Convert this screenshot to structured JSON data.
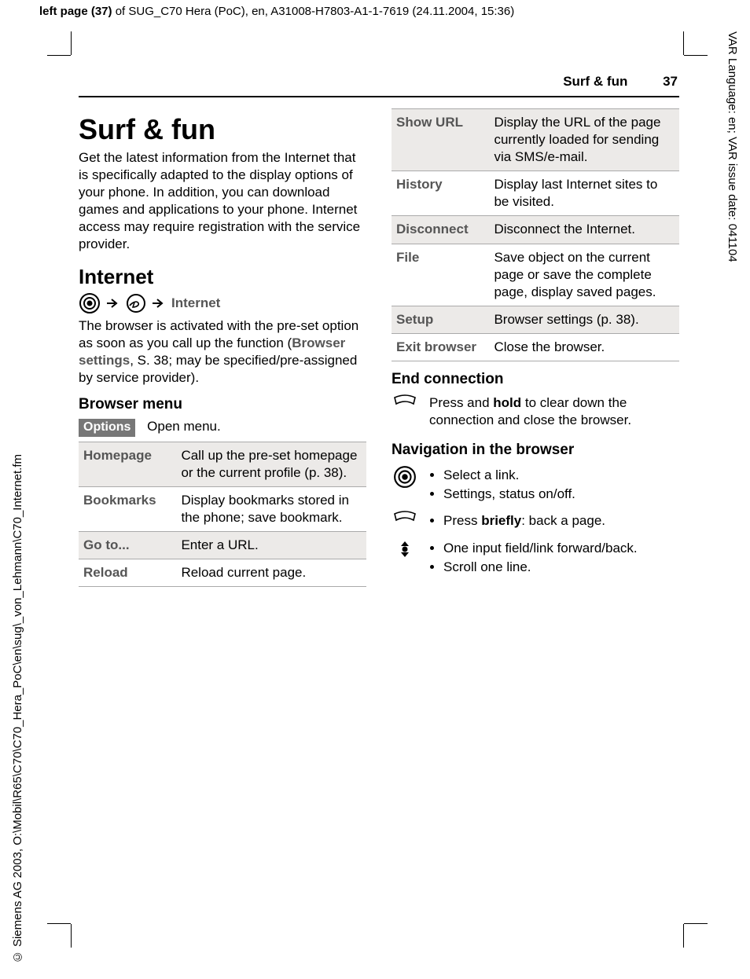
{
  "meta": {
    "top_label": "left page (37)",
    "top_rest": " of SUG_C70 Hera (PoC), en, A31008-H7803-A1-1-7619 (24.11.2004, 15:36)",
    "side_right": "VAR Language: en; VAR issue date: 041104",
    "side_left": "© Siemens AG 2003, O:\\Mobil\\R65\\C70\\C70_Hera_PoC\\en\\sug\\_von_Lehmann\\C70_Internet.fm"
  },
  "running_head": {
    "title": "Surf & fun",
    "page": "37"
  },
  "h1": "Surf & fun",
  "intro": "Get the latest information from the Internet that is specifically adapted to the display options of your phone. In addition, you can download games and applications to your phone. Internet access may require registration with the service provider.",
  "internet": {
    "heading": "Internet",
    "path_label": "Internet",
    "after1": "The browser is activated with the pre-set option as soon as you call up the function (",
    "browser_settings": "Browser settings",
    "after2": ", S. 38; may be specified/pre-assigned by service provider)."
  },
  "browser_menu": {
    "heading": "Browser menu",
    "options": "Options",
    "open_menu": "Open menu.",
    "rows": [
      {
        "k": "Homepage",
        "v": "Call up the pre-set homepage or the current profile (p. 38)."
      },
      {
        "k": "Bookmarks",
        "v": "Display bookmarks stored in the phone; save bookmark."
      },
      {
        "k": "Go to...",
        "v": "Enter a URL."
      },
      {
        "k": "Reload",
        "v": "Reload current page."
      }
    ]
  },
  "right_rows": [
    {
      "k": "Show URL",
      "v": "Display the URL of the page currently loaded for sending via SMS/e-mail."
    },
    {
      "k": "History",
      "v": "Display last Internet sites to be visited."
    },
    {
      "k": "Disconnect",
      "v": "Disconnect the Internet."
    },
    {
      "k": "File",
      "v": "Save object on the current page or save the complete page, display saved pages."
    },
    {
      "k": "Setup",
      "v": "Browser settings (p. 38)."
    },
    {
      "k": "Exit browser",
      "v": "Close the browser."
    }
  ],
  "end_conn": {
    "heading": "End connection",
    "text1": "Press and ",
    "hold": "hold",
    "text2": " to clear down the connection and close the browser."
  },
  "nav": {
    "heading": "Navigation in the browser",
    "center1": "Select a link.",
    "center2": "Settings, status on/off.",
    "back1": "Press ",
    "briefly": "briefly",
    "back2": ": back a page.",
    "arrow1": "One input field/link forward/back.",
    "arrow2": "Scroll one line."
  }
}
